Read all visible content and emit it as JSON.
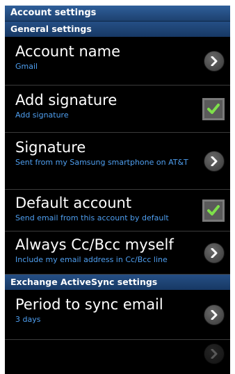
{
  "title_bar": {
    "label": "Account settings"
  },
  "sections": {
    "general": {
      "header": "General settings"
    },
    "exchange": {
      "header": "Exchange ActiveSync settings"
    }
  },
  "rows": {
    "account_name": {
      "title": "Account name",
      "subtitle": "Gmail",
      "control": "chevron-right-icon"
    },
    "add_signature": {
      "title": "Add signature",
      "subtitle": "Add signature",
      "control": "checkbox",
      "checked": true
    },
    "signature": {
      "title": "Signature",
      "subtitle": "Sent from my Samsung smartphone on AT&T",
      "control": "chevron-right-icon"
    },
    "default_account": {
      "title": "Default account",
      "subtitle": "Send email from this account by default",
      "control": "checkbox",
      "checked": true
    },
    "always_cc": {
      "title": "Always Cc/Bcc myself",
      "subtitle": "Include my email address in Cc/Bcc line",
      "control": "chevron-right-icon"
    },
    "period_sync": {
      "title": "Period to sync email",
      "subtitle": "3 days",
      "control": "chevron-right-icon"
    }
  },
  "colors": {
    "title_bar": "#2f5f9a",
    "section_header": "#254f85",
    "subtitle_text": "#4f9ff0",
    "check_mark": "#7ee04a",
    "background": "#000000"
  }
}
